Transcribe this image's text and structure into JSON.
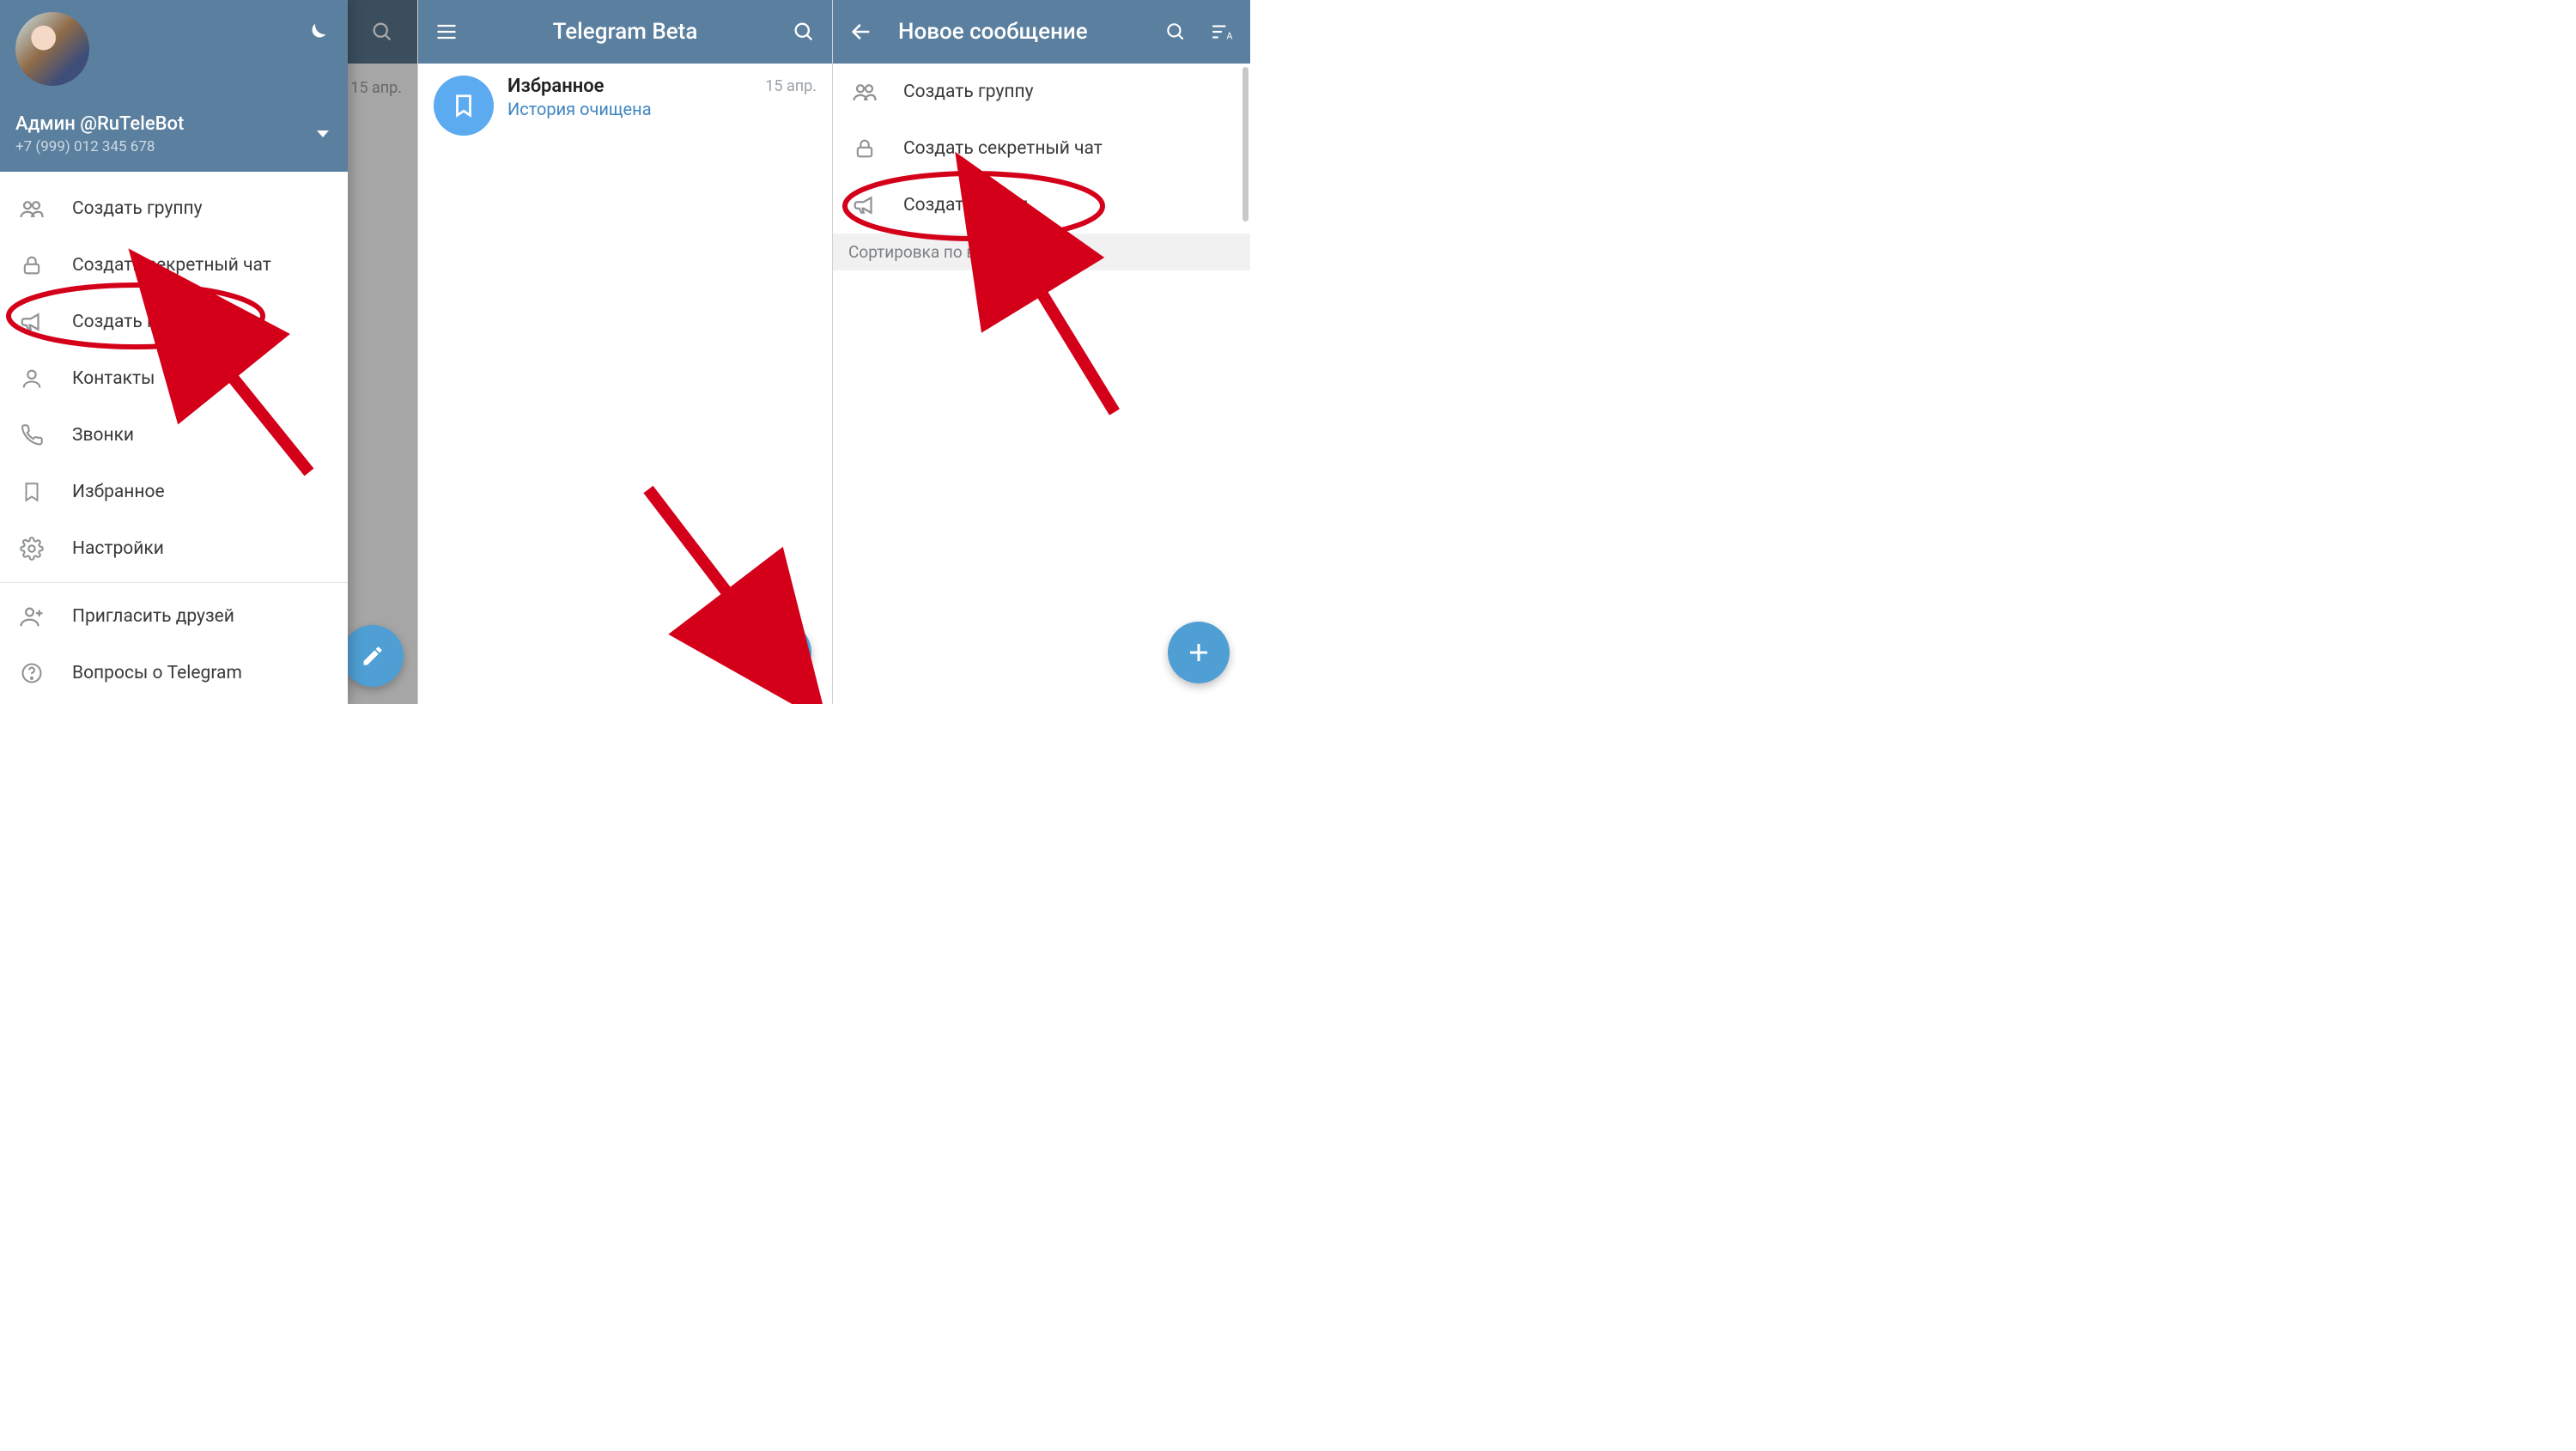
{
  "colors": {
    "toolbar": "#5b7f9e",
    "toolbar_dim": "#4f6e87",
    "accent_fab": "#4f9fd4",
    "saved_avatar": "#5caaef",
    "link_text": "#3f86c1",
    "annotation_red": "#d4001a"
  },
  "panel1": {
    "behind_date": "15 апр.",
    "account": {
      "name": "Админ @RuTeleBot",
      "phone": "+7 (999) 012 345 678"
    },
    "menu": [
      {
        "icon": "group-icon",
        "label": "Создать группу"
      },
      {
        "icon": "lock-icon",
        "label": "Создать секретный чат"
      },
      {
        "icon": "megaphone-icon",
        "label": "Создать канал"
      },
      {
        "icon": "contacts-icon",
        "label": "Контакты"
      },
      {
        "icon": "phone-icon",
        "label": "Звонки"
      },
      {
        "icon": "bookmark-icon",
        "label": "Избранное"
      },
      {
        "icon": "settings-icon",
        "label": "Настройки"
      }
    ],
    "menu_secondary": [
      {
        "icon": "invite-icon",
        "label": "Пригласить друзей"
      },
      {
        "icon": "help-icon",
        "label": "Вопросы о Telegram"
      }
    ]
  },
  "panel2": {
    "title": "Telegram Beta",
    "chats": [
      {
        "title": "Избранное",
        "subtitle": "История очищена",
        "date": "15 апр."
      }
    ]
  },
  "panel3": {
    "title": "Новое сообщение",
    "create": [
      {
        "icon": "group-icon",
        "label": "Создать группу"
      },
      {
        "icon": "lock-icon",
        "label": "Создать секретный чат"
      },
      {
        "icon": "megaphone-icon",
        "label": "Создать канал"
      }
    ],
    "sort_header": "Сортировка по времени входа"
  }
}
